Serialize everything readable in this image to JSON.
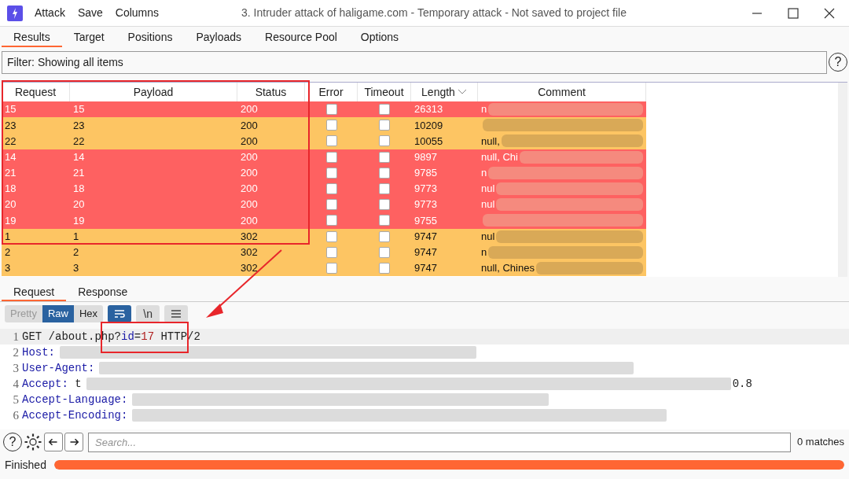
{
  "window": {
    "title": "3. Intruder attack of haligame.com - Temporary attack - Not saved to project file"
  },
  "menu": [
    "Attack",
    "Save",
    "Columns"
  ],
  "tabs": [
    {
      "label": "Results",
      "selected": true
    },
    {
      "label": "Target",
      "selected": false
    },
    {
      "label": "Positions",
      "selected": false
    },
    {
      "label": "Payloads",
      "selected": false
    },
    {
      "label": "Resource Pool",
      "selected": false
    },
    {
      "label": "Options",
      "selected": false
    }
  ],
  "filter": {
    "text": "Filter: Showing all items",
    "help": "?"
  },
  "table": {
    "columns": [
      {
        "label": "Request",
        "sorted": false
      },
      {
        "label": "Payload",
        "sorted": false
      },
      {
        "label": "Status",
        "sorted": false
      },
      {
        "label": "Error",
        "sorted": false
      },
      {
        "label": "Timeout",
        "sorted": false
      },
      {
        "label": "Length",
        "sorted": true
      },
      {
        "label": "Comment",
        "sorted": false
      }
    ],
    "rows": [
      {
        "request": "15",
        "payload": "15",
        "status": "200",
        "error": false,
        "timeout": false,
        "length": "26313",
        "comment": "n",
        "color": "#fe6161"
      },
      {
        "request": "23",
        "payload": "23",
        "status": "200",
        "error": false,
        "timeout": false,
        "length": "10209",
        "comment": "",
        "color": "#fdc563"
      },
      {
        "request": "22",
        "payload": "22",
        "status": "200",
        "error": false,
        "timeout": false,
        "length": "10055",
        "comment": "null,",
        "color": "#fdc563"
      },
      {
        "request": "14",
        "payload": "14",
        "status": "200",
        "error": false,
        "timeout": false,
        "length": "9897",
        "comment": "null, Chi",
        "color": "#fe6161"
      },
      {
        "request": "21",
        "payload": "21",
        "status": "200",
        "error": false,
        "timeout": false,
        "length": "9785",
        "comment": "n",
        "color": "#fe6161"
      },
      {
        "request": "18",
        "payload": "18",
        "status": "200",
        "error": false,
        "timeout": false,
        "length": "9773",
        "comment": "nul",
        "color": "#fe6161"
      },
      {
        "request": "20",
        "payload": "20",
        "status": "200",
        "error": false,
        "timeout": false,
        "length": "9773",
        "comment": "nul",
        "color": "#fe6161"
      },
      {
        "request": "19",
        "payload": "19",
        "status": "200",
        "error": false,
        "timeout": false,
        "length": "9755",
        "comment": "",
        "color": "#fe6161"
      },
      {
        "request": "1",
        "payload": "1",
        "status": "302",
        "error": false,
        "timeout": false,
        "length": "9747",
        "comment": "nul",
        "color": "#fdc563"
      },
      {
        "request": "2",
        "payload": "2",
        "status": "302",
        "error": false,
        "timeout": false,
        "length": "9747",
        "comment": "n",
        "color": "#fdc563"
      },
      {
        "request": "3",
        "payload": "3",
        "status": "302",
        "error": false,
        "timeout": false,
        "length": "9747",
        "comment": "null, Chines",
        "color": "#fdc563"
      }
    ]
  },
  "detail_tabs": [
    {
      "label": "Request",
      "selected": true
    },
    {
      "label": "Response",
      "selected": false
    }
  ],
  "view_modes": [
    {
      "label": "Pretty",
      "selected": false
    },
    {
      "label": "Raw",
      "selected": true
    },
    {
      "label": "Hex",
      "selected": false
    }
  ],
  "tool_buttons": [
    {
      "kind": "wrap",
      "selected": true
    },
    {
      "label": "\\n",
      "kind": "text",
      "selected": false
    },
    {
      "kind": "menu",
      "selected": false
    }
  ],
  "code_lines": [
    {
      "number": "1",
      "parts": [
        {
          "text": "GET /about.php?",
          "kind": "plain"
        },
        {
          "text": "id",
          "kind": "key"
        },
        {
          "text": "=",
          "kind": "plain"
        },
        {
          "text": "17",
          "kind": "value"
        },
        {
          "text": " HTTP/2",
          "kind": "plain"
        }
      ],
      "redacted": false,
      "highlighted": true
    },
    {
      "number": "2",
      "parts": [
        {
          "text": "Host:",
          "kind": "key"
        }
      ],
      "redacted": true,
      "highlighted": false
    },
    {
      "number": "3",
      "parts": [
        {
          "text": "User-Agent:",
          "kind": "key"
        }
      ],
      "redacted": true,
      "highlighted": false
    },
    {
      "number": "4",
      "parts": [
        {
          "text": "Accept:",
          "kind": "key"
        },
        {
          "text": " t",
          "kind": "plain"
        }
      ],
      "redacted": true,
      "tail": "0.8",
      "highlighted": false
    },
    {
      "number": "5",
      "parts": [
        {
          "text": "Accept-Language:",
          "kind": "key"
        }
      ],
      "redacted": true,
      "highlighted": false
    },
    {
      "number": "6",
      "parts": [
        {
          "text": "Accept-Encoding:",
          "kind": "key"
        }
      ],
      "redacted": true,
      "highlighted": false
    }
  ],
  "search": {
    "help": "?",
    "placeholder": "Search...",
    "matches": "0 matches"
  },
  "status_bar": {
    "text": "Finished",
    "level": 1
  },
  "annotations": [
    {
      "kind": "box"
    },
    {
      "kind": "box"
    },
    {
      "kind": "arrow"
    }
  ]
}
